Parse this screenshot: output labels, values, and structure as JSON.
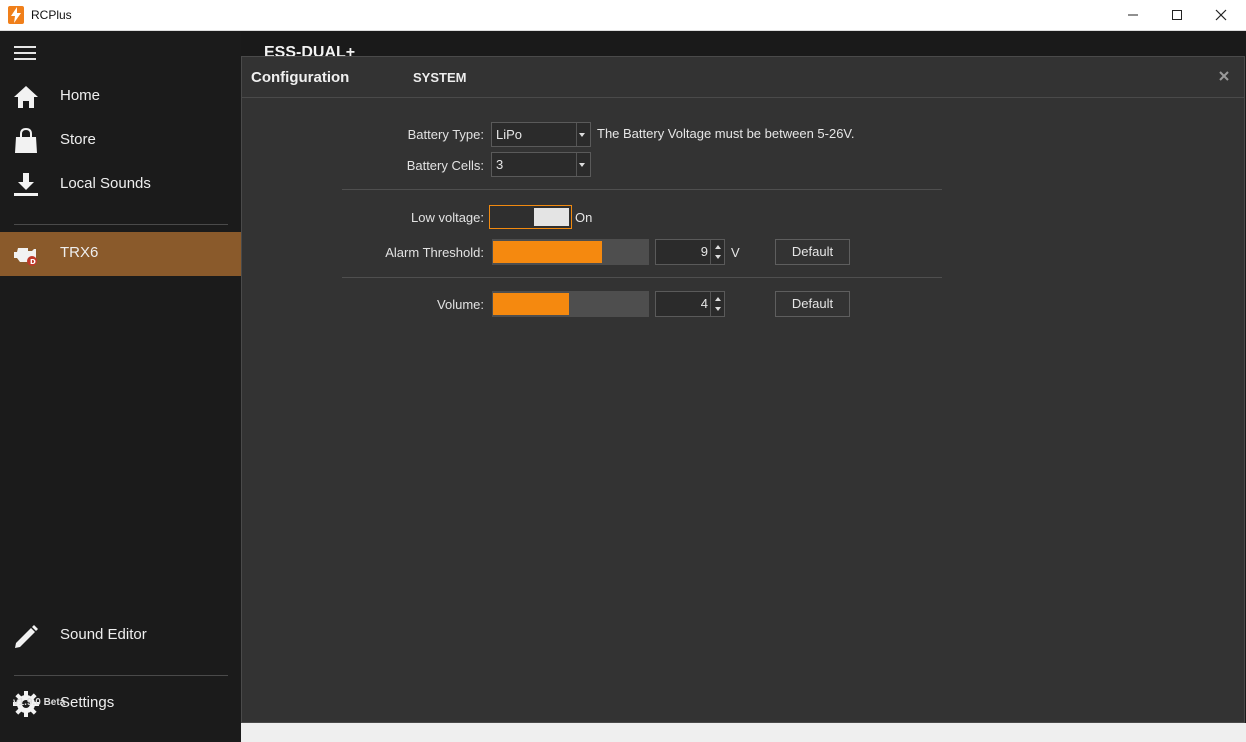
{
  "window": {
    "title": "RCPlus",
    "icon": "lightning-icon",
    "controls": [
      "minimize-icon",
      "maximize-icon",
      "close-icon"
    ]
  },
  "sidebar": {
    "menu_icon": "hamburger-icon",
    "items": [
      {
        "label": "Home",
        "icon": "home-icon"
      },
      {
        "label": "Store",
        "icon": "shopping-bag-icon"
      },
      {
        "label": "Local Sounds",
        "icon": "download-icon"
      },
      {
        "label": "TRX6",
        "icon": "engine-icon",
        "active": true
      },
      {
        "label": "Sound Editor",
        "icon": "pencil-icon"
      },
      {
        "label": "Settings",
        "icon": "gear-icon"
      }
    ],
    "version": "v1.9.0 Beta"
  },
  "main": {
    "heading": "ESS-DUAL+"
  },
  "dialog": {
    "title": "Configuration",
    "tab": "SYSTEM",
    "close_icon": "close-icon",
    "battery_type": {
      "label": "Battery Type:",
      "value": "LiPo",
      "note": "The Battery Voltage must be between 5-26V."
    },
    "battery_cells": {
      "label": "Battery Cells:",
      "value": "3"
    },
    "low_voltage": {
      "label": "Low voltage:",
      "state": "On",
      "on": true
    },
    "alarm_threshold": {
      "label": "Alarm Threshold:",
      "value": "9",
      "unit": "V",
      "fill": 0.7,
      "default_label": "Default"
    },
    "volume": {
      "label": "Volume:",
      "value": "4",
      "fill": 0.49,
      "default_label": "Default"
    }
  },
  "colors": {
    "accent": "#f5890f",
    "active_nav": "#8a5a2b",
    "dialog_bg": "#333333",
    "sidebar_bg": "#1b1b1b"
  }
}
